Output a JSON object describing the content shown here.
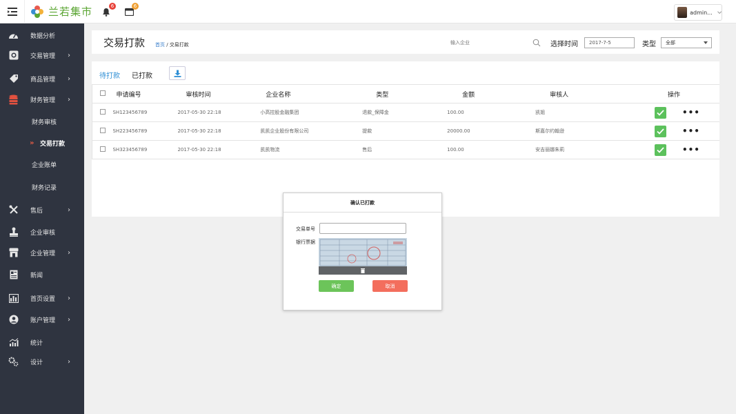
{
  "header": {
    "brand": "兰若集市",
    "notifications_count": "6",
    "calendar_count": "6",
    "user_name": "admin..."
  },
  "sidebar": {
    "items": [
      {
        "label": "数据分析",
        "icon": "dashboard-icon",
        "has_chevron": false
      },
      {
        "label": "交易管理",
        "icon": "money-icon",
        "has_chevron": true
      },
      {
        "label": "商品管理",
        "icon": "tag-icon",
        "has_chevron": true
      },
      {
        "label": "财务管理",
        "icon": "database-icon",
        "has_chevron": true
      },
      {
        "label": "售后",
        "icon": "tools-icon",
        "has_chevron": true
      },
      {
        "label": "企业审核",
        "icon": "stamp-icon",
        "has_chevron": false
      },
      {
        "label": "企业管理",
        "icon": "store-icon",
        "has_chevron": true
      },
      {
        "label": "新闻",
        "icon": "newspaper-icon",
        "has_chevron": false
      },
      {
        "label": "首页设置",
        "icon": "layout-icon",
        "has_chevron": true
      },
      {
        "label": "账户管理",
        "icon": "user-circle-icon",
        "has_chevron": true
      },
      {
        "label": "统计",
        "icon": "stats-icon",
        "has_chevron": false
      },
      {
        "label": "设计",
        "icon": "cogs-icon",
        "has_chevron": true
      }
    ],
    "sub_items": [
      {
        "label": "财务审核"
      },
      {
        "label": "交易打款",
        "active": true
      },
      {
        "label": "企业账单"
      },
      {
        "label": "财务记录"
      }
    ]
  },
  "title_bar": {
    "title": "交易打款",
    "breadcrumb_home": "首页",
    "breadcrumb_sep": " / ",
    "breadcrumb_current": "交易打款",
    "search_placeholder": "输入企业",
    "date_label": "选择时间",
    "date_value": "2017-7-5",
    "type_label": "类型",
    "type_value": "全部"
  },
  "tabs": [
    {
      "label": "待打款",
      "active": true
    },
    {
      "label": "已打款",
      "active": false
    }
  ],
  "table": {
    "columns": [
      "申请编号",
      "审核时间",
      "企业名称",
      "类型",
      "金额",
      "审核人",
      "操作"
    ],
    "rows": [
      {
        "id": "SH123456789",
        "time": "2017-05-30 22:18",
        "company": "小高控股金融集团",
        "type": "退款_保障金",
        "amount": "100.00",
        "reviewer": "凯姐"
      },
      {
        "id": "SH223456789",
        "time": "2017-05-30 22:18",
        "company": "凯凯企业股份有限公司",
        "type": "提款",
        "amount": "20000.00",
        "reviewer": "斯嘉尔约翰逊"
      },
      {
        "id": "SH323456789",
        "time": "2017-05-30 22:18",
        "company": "凯凯物流",
        "type": "售后",
        "amount": "100.00",
        "reviewer": "安吉丽娜朱莉"
      }
    ]
  },
  "modal": {
    "title": "确认已打款",
    "trade_no_label": "交易单号",
    "trade_no_value": "",
    "receipt_label": "银行票据",
    "ok_label": "确定",
    "cancel_label": "取消"
  },
  "colors": {
    "sidebar_bg": "#2f3440",
    "accent_blue": "#2f8fd5",
    "approve_green": "#5cc15c",
    "cancel_red": "#f36e5d",
    "badge_red": "#e8423a",
    "badge_orange": "#f0a033"
  }
}
